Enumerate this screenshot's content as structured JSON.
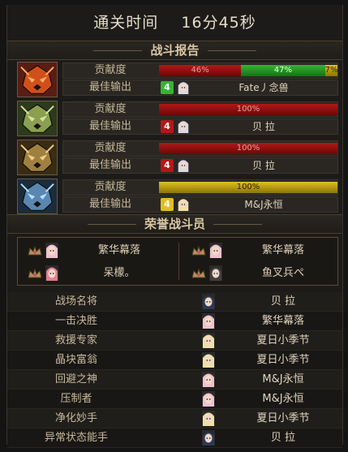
{
  "header": {
    "clear_time_label": "通关时间",
    "clear_time_value": "16分45秒"
  },
  "battle_report": {
    "title": "战斗报告",
    "contribution_label": "贡献度",
    "best_output_label": "最佳输出",
    "entries": [
      {
        "portrait": "red-demon-mask",
        "segments": [
          {
            "label": "46%",
            "value": 46,
            "color": "red"
          },
          {
            "label": "47%",
            "value": 47,
            "color": "green"
          },
          {
            "label": "7%",
            "value": 7,
            "color": "yellow"
          }
        ],
        "output_icon": "green",
        "output_name": "Fate丿念兽"
      },
      {
        "portrait": "green-demon-mask",
        "segments": [
          {
            "label": "100%",
            "value": 100,
            "color": "red"
          }
        ],
        "output_icon": "red",
        "output_name": "贝 拉"
      },
      {
        "portrait": "gold-demon-mask",
        "segments": [
          {
            "label": "100%",
            "value": 100,
            "color": "red"
          }
        ],
        "output_icon": "red",
        "output_name": "贝 拉"
      },
      {
        "portrait": "blue-demon-mask",
        "segments": [
          {
            "label": "100%",
            "value": 100,
            "color": "yellow"
          }
        ],
        "output_icon": "yellow",
        "output_name": "M&J永恒"
      }
    ]
  },
  "honor": {
    "title": "荣誉战斗员",
    "members": [
      {
        "name": "繁华幕落"
      },
      {
        "name": "繁华幕落"
      },
      {
        "name": "呆檬。"
      },
      {
        "name": "鱼叉兵ぺ"
      }
    ]
  },
  "awards": [
    {
      "title": "战场名将",
      "name": "贝 拉"
    },
    {
      "title": "一击决胜",
      "name": "繁华幕落"
    },
    {
      "title": "救援专家",
      "name": "夏日小季节"
    },
    {
      "title": "晶块富翁",
      "name": "夏日小季节"
    },
    {
      "title": "回避之神",
      "name": "M&J永恒"
    },
    {
      "title": "压制者",
      "name": "M&J永恒"
    },
    {
      "title": "净化妙手",
      "name": "夏日小季节"
    },
    {
      "title": "异常状态能手",
      "name": "贝 拉"
    }
  ],
  "colors": {
    "red": "#b21818",
    "green": "#39b236",
    "yellow": "#e0c020"
  }
}
